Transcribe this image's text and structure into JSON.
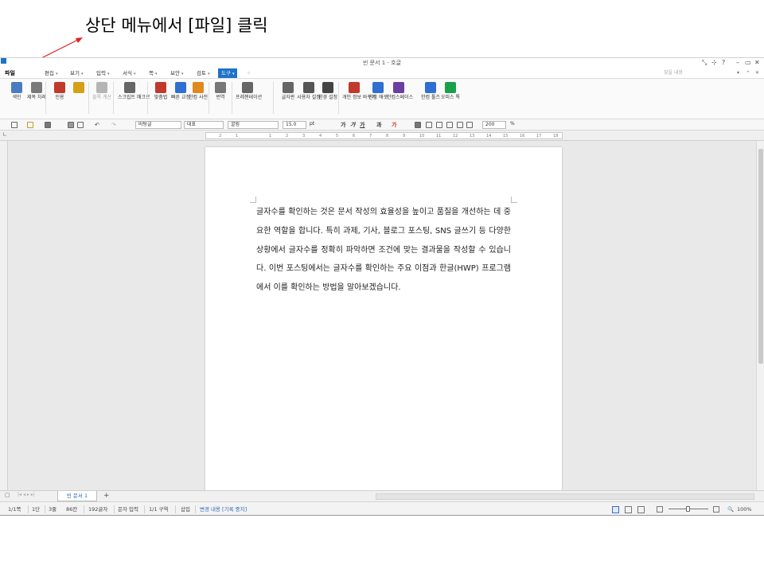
{
  "instruction": "상단 메뉴에서 [파일] 클릭",
  "window": {
    "title": "빈 문서 1 - 호글",
    "controls": [
      "?",
      "–",
      "▭",
      "✕"
    ]
  },
  "menu": {
    "file": "파일",
    "items": [
      "편집",
      "보기",
      "입력",
      "서식",
      "쪽",
      "보안",
      "검토"
    ],
    "tools": "도구",
    "help_placeholder": "찾을 내용"
  },
  "ribbon": [
    {
      "name": "index",
      "label": "색인",
      "color": "#4a7cc1"
    },
    {
      "name": "title-toc",
      "label": "제목 차례",
      "color": "#7a7a7a"
    },
    {
      "name": "citation",
      "label": "인용",
      "color": "#c0392b"
    },
    {
      "name": "citation2",
      "label": "",
      "color": "#d4a017"
    },
    {
      "name": "block-calc",
      "label": "블록 계산",
      "color": "#b5b5b5",
      "disabled": true
    },
    {
      "name": "script-macro",
      "label": "스크립트 매크로",
      "color": "#666666"
    },
    {
      "name": "spellcheck",
      "label": "맞춤법",
      "color": "#c0392b"
    },
    {
      "name": "quick-correct",
      "label": "빠른 교정",
      "color": "#2e6fd1"
    },
    {
      "name": "hanja-dict",
      "label": "한컴 사전",
      "color": "#e08a1e"
    },
    {
      "name": "translate",
      "label": "번역",
      "color": "#777777"
    },
    {
      "name": "presentation",
      "label": "프레젠테이션",
      "color": "#666666"
    },
    {
      "name": "keyboard",
      "label": "글자판",
      "color": "#666666"
    },
    {
      "name": "user-settings",
      "label": "사용자 설정",
      "color": "#555555"
    },
    {
      "name": "env-settings",
      "label": "환경 설정",
      "color": "#444444"
    },
    {
      "name": "privacy",
      "label": "개인 정보 바꾸기",
      "color": "#c0392b"
    },
    {
      "name": "hancom-ash",
      "label": "한컴 애셋",
      "color": "#2e6fd1"
    },
    {
      "name": "hancom-space",
      "label": "한컴스페이스",
      "color": "#6b3fa0"
    },
    {
      "name": "hancom-tools",
      "label": "한컴 툴즈",
      "color": "#2e6fd1"
    },
    {
      "name": "office-tok",
      "label": "오피스 톡",
      "color": "#1aa04a"
    }
  ],
  "format_bar": {
    "style": "바탕글",
    "language": "대표",
    "font": "굴림",
    "size": "15.0",
    "unit": "pt",
    "bold": "가",
    "italic": "가",
    "underline": "가",
    "zoom": "200",
    "zoom_unit": "%"
  },
  "ruler_numbers": [
    "2",
    "1",
    "",
    "1",
    "2",
    "3",
    "4",
    "5",
    "6",
    "7",
    "8",
    "9",
    "10",
    "11",
    "12",
    "13",
    "14",
    "15",
    "16",
    "17",
    "18"
  ],
  "document": {
    "text": "글자수를 확인하는 것은 문서 작성의 효율성을 높이고 품질을 개선하는 데 중요한 역할을 합니다. 특히 과제, 기사, 블로그 포스팅, SNS 글쓰기 등 다양한 상황에서 글자수를 정확히 파악하면 조건에 맞는 결과물을 작성할 수 있습니다. 이번 포스팅에서는 글자수를 확인하는 주요 이점과 한글(HWP) 프로그램에서 이를 확인하는 방법을 알아보겠습니다."
  },
  "tabs": {
    "doc_tab": "빈 문서 1",
    "add": "+"
  },
  "status": {
    "page": "1/1쪽",
    "column": "1단",
    "line": "3줄",
    "col_pos": "86칸",
    "chars": "192글자",
    "mode": "문자 입력",
    "section": "1/1 구역",
    "insert": "삽입",
    "track": "변경 내용 [기록 중지]",
    "zoom": "100%"
  }
}
